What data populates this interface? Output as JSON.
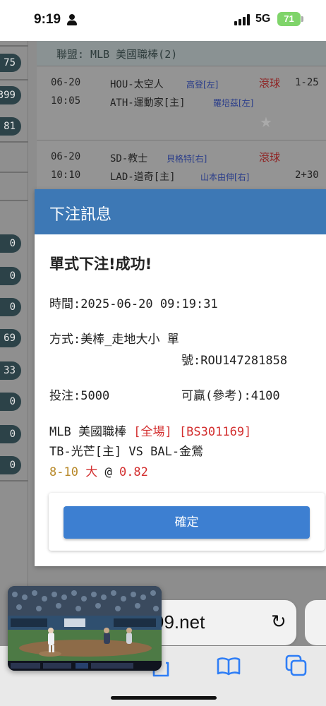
{
  "status_bar": {
    "time": "9:19",
    "network": "5G",
    "battery": "71"
  },
  "background": {
    "left_values": [
      "75",
      "399",
      "81",
      "0",
      "0",
      "0",
      "69",
      "33",
      "0",
      "0",
      "0"
    ],
    "league": "聯盟: MLB 美國職棒(2)",
    "games": [
      {
        "date": "06-20",
        "time": "10:05",
        "away": "HOU-太空人",
        "away_pitcher": "高登[左]",
        "home": "ATH-運動家[主]",
        "home_pitcher": "羅培茲[左]",
        "tag": "滾球",
        "line": "1-25"
      },
      {
        "date": "06-20",
        "time": "10:10",
        "away": "SD-教士",
        "away_pitcher": "貝格特[右]",
        "home": "LAD-道奇[主]",
        "home_pitcher": "山本由伸[右]",
        "tag": "滾球",
        "line": "2+30"
      }
    ]
  },
  "modal": {
    "title": "下注訊息",
    "success": "單式下注!成功!",
    "time_label": "時間:",
    "time_value": "2025-06-20 09:19:31",
    "method": "方式:美棒_走地大小 單",
    "ticket": "號:ROU147281858",
    "stake": "投注:5000",
    "win": "可贏(參考):4100",
    "league_name": "MLB 美國職棒",
    "period": "[全場]",
    "bet_code": "[BS301169]",
    "matchup": "TB-光芒[主] VS BAL-金鶯",
    "score": "8-10",
    "pick": "大",
    "at": "@",
    "odds": "0.82",
    "confirm": "確定"
  },
  "browser": {
    "url_fragment": "99.net"
  },
  "colors": {
    "header_blue": "#3d78b5",
    "button_blue": "#3d7fd1",
    "accent_red": "#d32f2f",
    "score_gold": "#b8892a",
    "battery_green": "#7fd46a"
  },
  "icons": {
    "person": "person-icon",
    "signal": "signal-icon",
    "reload": "reload-icon",
    "back": "back-icon",
    "bookmarks": "book-icon",
    "tabs": "tabs-icon",
    "star": "star-icon"
  }
}
